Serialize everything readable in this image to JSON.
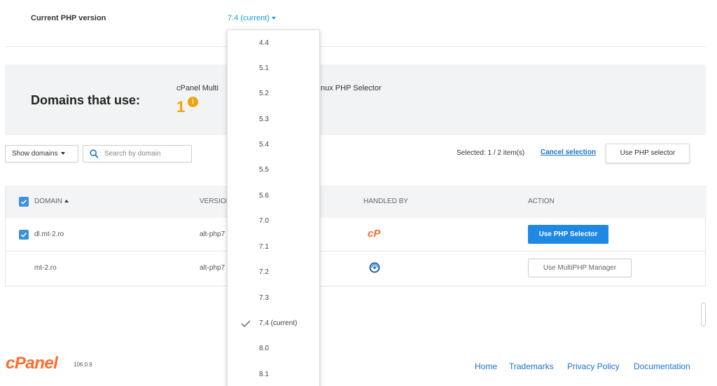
{
  "current_php": {
    "label": "Current PHP version",
    "value": "7.4 (current)"
  },
  "domains_panel": {
    "title": "Domains that use:",
    "description": "cPanel Multi PHP Manager / CloudLinux PHP Selector",
    "description_visible_left": "cPanel Multi",
    "description_visible_right": "nux PHP Selector",
    "count": "1"
  },
  "toolbar": {
    "show_domains_label": "Show domains",
    "search_placeholder": "Search by domain",
    "selected_text": "Selected: 1 / 2 item(s)",
    "cancel_selection": "Cancel selection",
    "use_php_selector": "Use PHP selector"
  },
  "table": {
    "headers": {
      "domain": "DOMAIN",
      "version": "VERSION",
      "handled_by": "HANDLED BY",
      "action": "ACTION"
    },
    "rows": [
      {
        "domain": "dl.mt-2.ro",
        "version": "alt-php7",
        "handled_by": "cpanel-icon",
        "action": "Use PHP Selector",
        "checked": true
      },
      {
        "domain": "mt-2.ro",
        "version": "alt-php7",
        "handled_by": "cloudlinux-icon",
        "action": "Use MultiPHP Manager",
        "checked": false
      }
    ]
  },
  "php_versions": {
    "items": [
      "4.4",
      "5.1",
      "5.2",
      "5.3",
      "5.4",
      "5.5",
      "5.6",
      "7.0",
      "7.1",
      "7.2",
      "7.3",
      "7.4 (current)",
      "8.0",
      "8.1"
    ],
    "selected": "7.4 (current)"
  },
  "footer": {
    "logo": "cPanel",
    "version": "106.0.9",
    "links": [
      "Home",
      "Trademarks",
      "Privacy Policy",
      "Documentation"
    ]
  },
  "colors": {
    "accent": "#179bd7",
    "primary_button": "#1e88e5",
    "brand_orange": "#ff6c2c",
    "count_orange": "#f0a30a"
  }
}
